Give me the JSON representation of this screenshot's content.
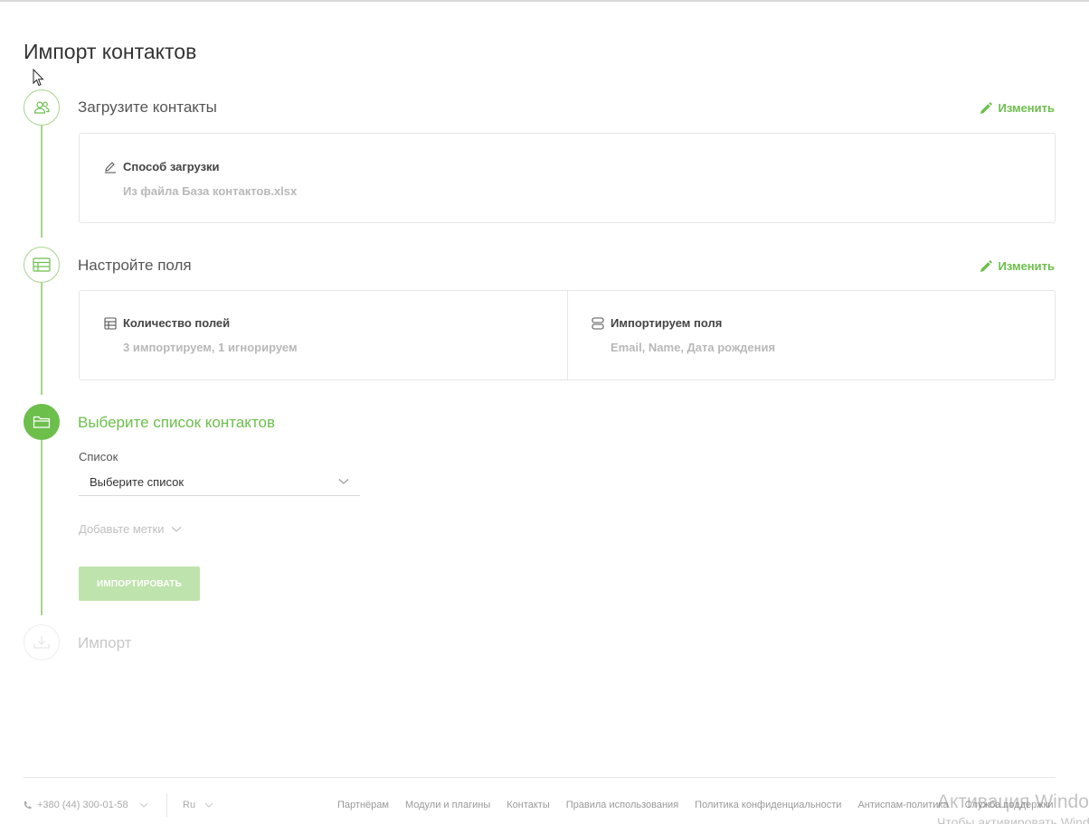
{
  "page": {
    "title": "Импорт контактов"
  },
  "steps": [
    {
      "title": "Загрузите контакты",
      "edit_label": "Изменить",
      "icon": "users-icon"
    },
    {
      "title": "Настройте поля",
      "edit_label": "Изменить",
      "icon": "table-icon"
    },
    {
      "title": "Выберите список контактов",
      "icon": "folder-icon"
    },
    {
      "title": "Импорт",
      "icon": "download-icon"
    }
  ],
  "upload_card": {
    "method_label": "Способ загрузки",
    "method_value": "Из файла База контактов.xlsx"
  },
  "fields_card": {
    "count_label": "Количество полей",
    "count_value": "3 импортируем, 1 игнорируем",
    "imported_label": "Импортируем поля",
    "imported_value": "Email, Name, Дата рождения"
  },
  "list_form": {
    "label": "Список",
    "select_value": "Выберите список",
    "tags_label": "Добавьте метки",
    "import_button": "ИМПОРТИРОВАТЬ"
  },
  "footer": {
    "phone": "+380 (44) 300-01-58",
    "lang": "Ru",
    "links": [
      "Партнёрам",
      "Модули и плагины",
      "Контакты",
      "Правила использования",
      "Политика конфиденциальности",
      "Антиспам-политика",
      "Служба поддержки"
    ]
  },
  "watermark": {
    "line1": "Активация Windows",
    "line2": "Чтобы активировать Windows"
  },
  "colors": {
    "accent": "#6cbf4b",
    "accent_light": "#a8d48e",
    "button_disabled": "#bfe3ad"
  }
}
